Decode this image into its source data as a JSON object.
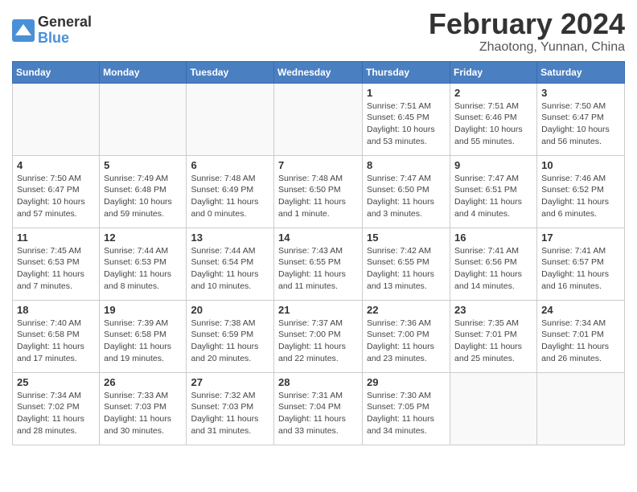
{
  "header": {
    "logo_general": "General",
    "logo_blue": "Blue",
    "month_title": "February 2024",
    "location": "Zhaotong, Yunnan, China"
  },
  "weekdays": [
    "Sunday",
    "Monday",
    "Tuesday",
    "Wednesday",
    "Thursday",
    "Friday",
    "Saturday"
  ],
  "weeks": [
    [
      {
        "day": "",
        "info": ""
      },
      {
        "day": "",
        "info": ""
      },
      {
        "day": "",
        "info": ""
      },
      {
        "day": "",
        "info": ""
      },
      {
        "day": "1",
        "info": "Sunrise: 7:51 AM\nSunset: 6:45 PM\nDaylight: 10 hours\nand 53 minutes."
      },
      {
        "day": "2",
        "info": "Sunrise: 7:51 AM\nSunset: 6:46 PM\nDaylight: 10 hours\nand 55 minutes."
      },
      {
        "day": "3",
        "info": "Sunrise: 7:50 AM\nSunset: 6:47 PM\nDaylight: 10 hours\nand 56 minutes."
      }
    ],
    [
      {
        "day": "4",
        "info": "Sunrise: 7:50 AM\nSunset: 6:47 PM\nDaylight: 10 hours\nand 57 minutes."
      },
      {
        "day": "5",
        "info": "Sunrise: 7:49 AM\nSunset: 6:48 PM\nDaylight: 10 hours\nand 59 minutes."
      },
      {
        "day": "6",
        "info": "Sunrise: 7:48 AM\nSunset: 6:49 PM\nDaylight: 11 hours\nand 0 minutes."
      },
      {
        "day": "7",
        "info": "Sunrise: 7:48 AM\nSunset: 6:50 PM\nDaylight: 11 hours\nand 1 minute."
      },
      {
        "day": "8",
        "info": "Sunrise: 7:47 AM\nSunset: 6:50 PM\nDaylight: 11 hours\nand 3 minutes."
      },
      {
        "day": "9",
        "info": "Sunrise: 7:47 AM\nSunset: 6:51 PM\nDaylight: 11 hours\nand 4 minutes."
      },
      {
        "day": "10",
        "info": "Sunrise: 7:46 AM\nSunset: 6:52 PM\nDaylight: 11 hours\nand 6 minutes."
      }
    ],
    [
      {
        "day": "11",
        "info": "Sunrise: 7:45 AM\nSunset: 6:53 PM\nDaylight: 11 hours\nand 7 minutes."
      },
      {
        "day": "12",
        "info": "Sunrise: 7:44 AM\nSunset: 6:53 PM\nDaylight: 11 hours\nand 8 minutes."
      },
      {
        "day": "13",
        "info": "Sunrise: 7:44 AM\nSunset: 6:54 PM\nDaylight: 11 hours\nand 10 minutes."
      },
      {
        "day": "14",
        "info": "Sunrise: 7:43 AM\nSunset: 6:55 PM\nDaylight: 11 hours\nand 11 minutes."
      },
      {
        "day": "15",
        "info": "Sunrise: 7:42 AM\nSunset: 6:55 PM\nDaylight: 11 hours\nand 13 minutes."
      },
      {
        "day": "16",
        "info": "Sunrise: 7:41 AM\nSunset: 6:56 PM\nDaylight: 11 hours\nand 14 minutes."
      },
      {
        "day": "17",
        "info": "Sunrise: 7:41 AM\nSunset: 6:57 PM\nDaylight: 11 hours\nand 16 minutes."
      }
    ],
    [
      {
        "day": "18",
        "info": "Sunrise: 7:40 AM\nSunset: 6:58 PM\nDaylight: 11 hours\nand 17 minutes."
      },
      {
        "day": "19",
        "info": "Sunrise: 7:39 AM\nSunset: 6:58 PM\nDaylight: 11 hours\nand 19 minutes."
      },
      {
        "day": "20",
        "info": "Sunrise: 7:38 AM\nSunset: 6:59 PM\nDaylight: 11 hours\nand 20 minutes."
      },
      {
        "day": "21",
        "info": "Sunrise: 7:37 AM\nSunset: 7:00 PM\nDaylight: 11 hours\nand 22 minutes."
      },
      {
        "day": "22",
        "info": "Sunrise: 7:36 AM\nSunset: 7:00 PM\nDaylight: 11 hours\nand 23 minutes."
      },
      {
        "day": "23",
        "info": "Sunrise: 7:35 AM\nSunset: 7:01 PM\nDaylight: 11 hours\nand 25 minutes."
      },
      {
        "day": "24",
        "info": "Sunrise: 7:34 AM\nSunset: 7:01 PM\nDaylight: 11 hours\nand 26 minutes."
      }
    ],
    [
      {
        "day": "25",
        "info": "Sunrise: 7:34 AM\nSunset: 7:02 PM\nDaylight: 11 hours\nand 28 minutes."
      },
      {
        "day": "26",
        "info": "Sunrise: 7:33 AM\nSunset: 7:03 PM\nDaylight: 11 hours\nand 30 minutes."
      },
      {
        "day": "27",
        "info": "Sunrise: 7:32 AM\nSunset: 7:03 PM\nDaylight: 11 hours\nand 31 minutes."
      },
      {
        "day": "28",
        "info": "Sunrise: 7:31 AM\nSunset: 7:04 PM\nDaylight: 11 hours\nand 33 minutes."
      },
      {
        "day": "29",
        "info": "Sunrise: 7:30 AM\nSunset: 7:05 PM\nDaylight: 11 hours\nand 34 minutes."
      },
      {
        "day": "",
        "info": ""
      },
      {
        "day": "",
        "info": ""
      }
    ]
  ]
}
